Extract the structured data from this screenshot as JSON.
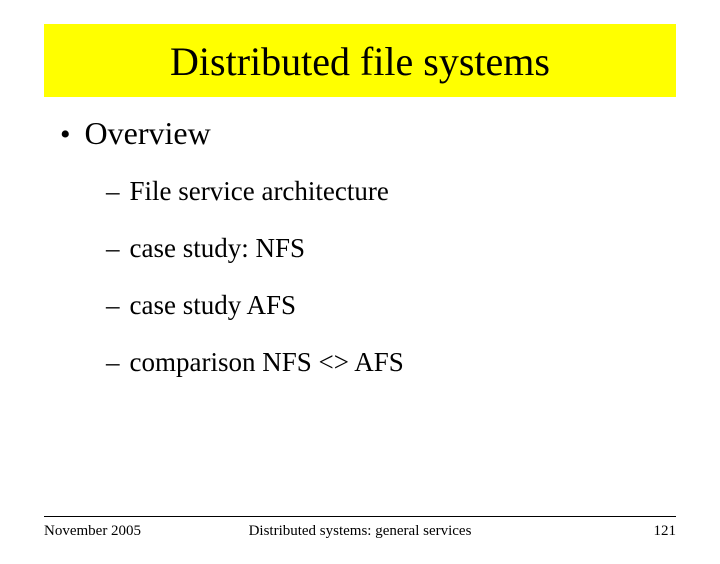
{
  "title": "Distributed file systems",
  "bullet": {
    "label": "Overview",
    "subitems": [
      "File service architecture",
      "case study: NFS",
      "case study AFS",
      "comparison NFS <> AFS"
    ]
  },
  "footer": {
    "date": "November 2005",
    "center": "Distributed systems: general services",
    "page": "121"
  }
}
